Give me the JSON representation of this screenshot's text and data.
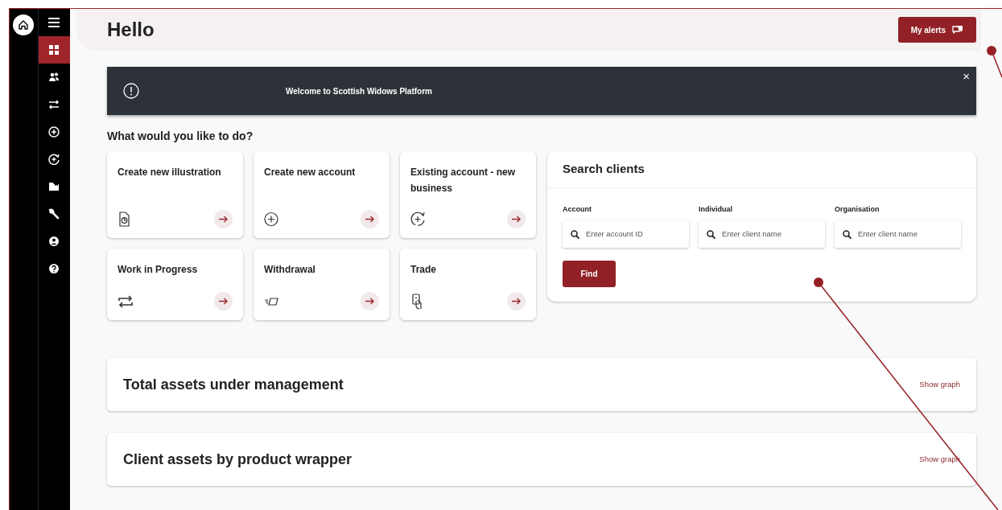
{
  "header": {
    "title": "Hello",
    "alerts_button": "My alerts"
  },
  "nav": [
    {
      "selected": true
    },
    {
      "selected": false
    },
    {
      "selected": false
    },
    {
      "selected": false
    },
    {
      "selected": false
    },
    {
      "selected": false
    },
    {
      "selected": false
    },
    {
      "selected": false
    },
    {
      "selected": false
    }
  ],
  "banner": {
    "text": "Welcome to Scottish Widows Platform",
    "close": "×"
  },
  "actions": {
    "heading": "What would you like to do?",
    "cards": [
      {
        "title": "Create new illustration"
      },
      {
        "title": "Create new account"
      },
      {
        "title": "Existing account - new business"
      },
      {
        "title": "Work in Progress"
      },
      {
        "title": "Withdrawal"
      },
      {
        "title": "Trade"
      }
    ]
  },
  "search_clients": {
    "title": "Search clients",
    "fields": [
      {
        "label": "Account",
        "placeholder": "Enter account ID"
      },
      {
        "label": "Individual",
        "placeholder": "Enter client name"
      },
      {
        "label": "Organisation",
        "placeholder": "Enter client name"
      }
    ],
    "button": "Find"
  },
  "panels": [
    {
      "title": "Total assets under management",
      "link": "Show graph"
    },
    {
      "title": "Client assets by product wrapper",
      "link": "Show graph"
    }
  ]
}
